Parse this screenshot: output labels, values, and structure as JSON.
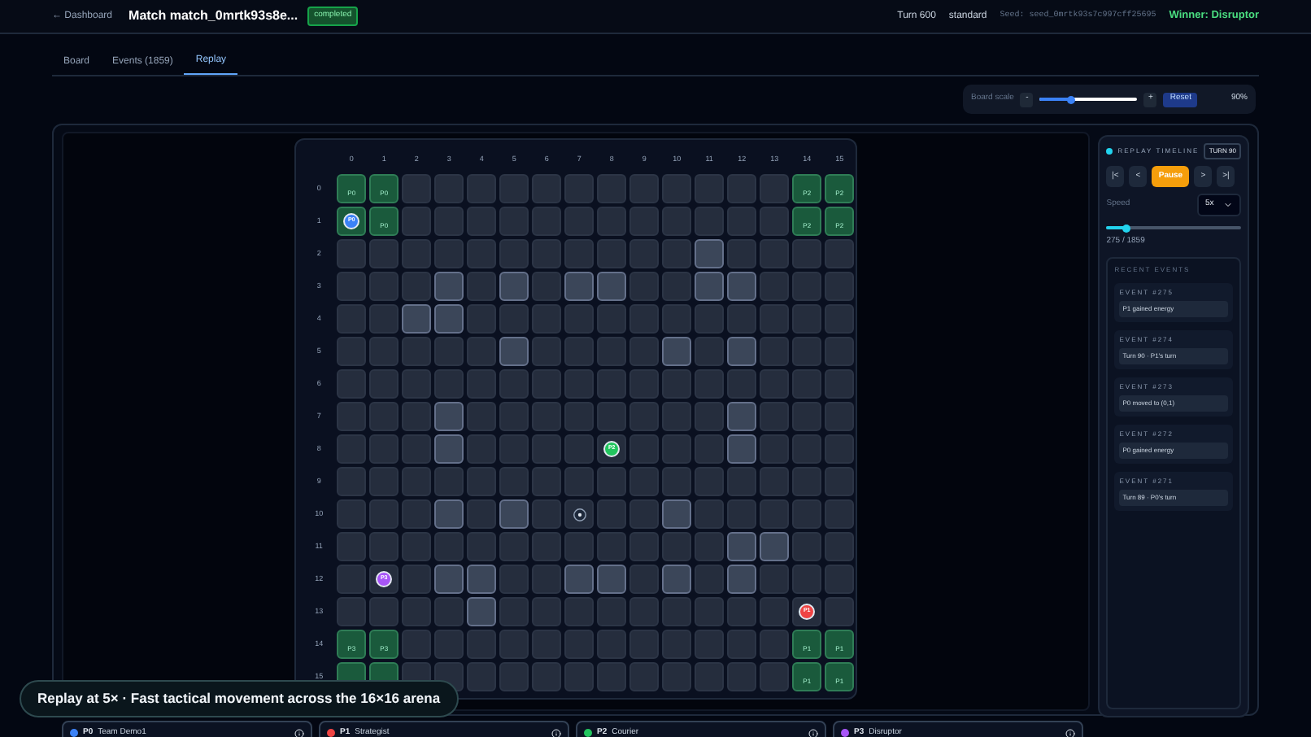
{
  "header": {
    "back_link": "← Dashboard",
    "title": "Match match_0mrtk93s8e...",
    "status_badge": "completed",
    "turn": "Turn 600",
    "mode": "standard",
    "seed": "Seed: seed_0mrtk93s7c997cff25695",
    "winner": "Winner: Disruptor"
  },
  "tabs": [
    {
      "label": "Board",
      "selected": false
    },
    {
      "label": "Events (1859)",
      "selected": false
    },
    {
      "label": "Replay",
      "selected": true
    }
  ],
  "board_scale": {
    "label": "Board scale",
    "minus": "-",
    "plus": "+",
    "level": 0.32,
    "reset": "Reset",
    "value": "90%"
  },
  "board": {
    "column_labels": [
      "0",
      "1",
      "2",
      "3",
      "4",
      "5",
      "6",
      "7",
      "8",
      "9",
      "10",
      "11",
      "12",
      "13",
      "14",
      "15"
    ],
    "rows": [
      {
        "label": "0",
        "cells": [
          {
            "kind": "base",
            "label": "P0"
          },
          {
            "kind": "base",
            "label": "P0"
          },
          {
            "kind": "empty"
          },
          {
            "kind": "empty"
          },
          {
            "kind": "empty"
          },
          {
            "kind": "empty"
          },
          {
            "kind": "empty"
          },
          {
            "kind": "empty"
          },
          {
            "kind": "empty"
          },
          {
            "kind": "empty"
          },
          {
            "kind": "empty"
          },
          {
            "kind": "empty"
          },
          {
            "kind": "empty"
          },
          {
            "kind": "empty"
          },
          {
            "kind": "base",
            "label": "P2"
          },
          {
            "kind": "base",
            "label": "P2"
          }
        ]
      },
      {
        "label": "1",
        "cells": [
          {
            "kind": "base_token",
            "label": "P0",
            "color": "#3b82f6"
          },
          {
            "kind": "base",
            "label": "P0"
          },
          {
            "kind": "empty"
          },
          {
            "kind": "empty"
          },
          {
            "kind": "empty"
          },
          {
            "kind": "empty"
          },
          {
            "kind": "empty"
          },
          {
            "kind": "empty"
          },
          {
            "kind": "empty"
          },
          {
            "kind": "empty"
          },
          {
            "kind": "empty"
          },
          {
            "kind": "empty"
          },
          {
            "kind": "empty"
          },
          {
            "kind": "empty"
          },
          {
            "kind": "base",
            "label": "P2"
          },
          {
            "kind": "base",
            "label": "P2"
          }
        ]
      },
      {
        "label": "2",
        "cells": [
          {
            "kind": "empty"
          },
          {
            "kind": "empty"
          },
          {
            "kind": "empty"
          },
          {
            "kind": "empty"
          },
          {
            "kind": "empty"
          },
          {
            "kind": "empty"
          },
          {
            "kind": "empty"
          },
          {
            "kind": "empty"
          },
          {
            "kind": "empty"
          },
          {
            "kind": "empty"
          },
          {
            "kind": "empty"
          },
          {
            "kind": "wall"
          },
          {
            "kind": "empty"
          },
          {
            "kind": "empty"
          },
          {
            "kind": "empty"
          },
          {
            "kind": "empty"
          }
        ]
      },
      {
        "label": "3",
        "cells": [
          {
            "kind": "empty"
          },
          {
            "kind": "empty"
          },
          {
            "kind": "empty"
          },
          {
            "kind": "wall"
          },
          {
            "kind": "empty"
          },
          {
            "kind": "wall"
          },
          {
            "kind": "empty"
          },
          {
            "kind": "wall"
          },
          {
            "kind": "wall"
          },
          {
            "kind": "empty"
          },
          {
            "kind": "empty"
          },
          {
            "kind": "wall"
          },
          {
            "kind": "wall"
          },
          {
            "kind": "empty"
          },
          {
            "kind": "empty"
          },
          {
            "kind": "empty"
          }
        ]
      },
      {
        "label": "4",
        "cells": [
          {
            "kind": "empty"
          },
          {
            "kind": "empty"
          },
          {
            "kind": "wall"
          },
          {
            "kind": "wall"
          },
          {
            "kind": "empty"
          },
          {
            "kind": "empty"
          },
          {
            "kind": "empty"
          },
          {
            "kind": "empty"
          },
          {
            "kind": "empty"
          },
          {
            "kind": "empty"
          },
          {
            "kind": "empty"
          },
          {
            "kind": "empty"
          },
          {
            "kind": "empty"
          },
          {
            "kind": "empty"
          },
          {
            "kind": "empty"
          },
          {
            "kind": "empty"
          }
        ]
      },
      {
        "label": "5",
        "cells": [
          {
            "kind": "empty"
          },
          {
            "kind": "empty"
          },
          {
            "kind": "empty"
          },
          {
            "kind": "empty"
          },
          {
            "kind": "empty"
          },
          {
            "kind": "wall"
          },
          {
            "kind": "empty"
          },
          {
            "kind": "empty"
          },
          {
            "kind": "empty"
          },
          {
            "kind": "empty"
          },
          {
            "kind": "wall"
          },
          {
            "kind": "empty"
          },
          {
            "kind": "wall"
          },
          {
            "kind": "empty"
          },
          {
            "kind": "empty"
          },
          {
            "kind": "empty"
          }
        ]
      },
      {
        "label": "6",
        "cells": [
          {
            "kind": "empty"
          },
          {
            "kind": "empty"
          },
          {
            "kind": "empty"
          },
          {
            "kind": "empty"
          },
          {
            "kind": "empty"
          },
          {
            "kind": "empty"
          },
          {
            "kind": "empty"
          },
          {
            "kind": "empty"
          },
          {
            "kind": "empty"
          },
          {
            "kind": "empty"
          },
          {
            "kind": "empty"
          },
          {
            "kind": "empty"
          },
          {
            "kind": "empty"
          },
          {
            "kind": "empty"
          },
          {
            "kind": "empty"
          },
          {
            "kind": "empty"
          }
        ]
      },
      {
        "label": "7",
        "cells": [
          {
            "kind": "empty"
          },
          {
            "kind": "empty"
          },
          {
            "kind": "empty"
          },
          {
            "kind": "wall"
          },
          {
            "kind": "empty"
          },
          {
            "kind": "empty"
          },
          {
            "kind": "empty"
          },
          {
            "kind": "empty"
          },
          {
            "kind": "empty"
          },
          {
            "kind": "empty"
          },
          {
            "kind": "empty"
          },
          {
            "kind": "empty"
          },
          {
            "kind": "wall"
          },
          {
            "kind": "empty"
          },
          {
            "kind": "empty"
          },
          {
            "kind": "empty"
          }
        ]
      },
      {
        "label": "8",
        "cells": [
          {
            "kind": "empty"
          },
          {
            "kind": "empty"
          },
          {
            "kind": "empty"
          },
          {
            "kind": "wall"
          },
          {
            "kind": "empty"
          },
          {
            "kind": "empty"
          },
          {
            "kind": "empty"
          },
          {
            "kind": "empty"
          },
          {
            "kind": "token",
            "label": "P2",
            "color": "#22c55e"
          },
          {
            "kind": "empty"
          },
          {
            "kind": "empty"
          },
          {
            "kind": "empty"
          },
          {
            "kind": "wall"
          },
          {
            "kind": "empty"
          },
          {
            "kind": "empty"
          },
          {
            "kind": "empty"
          }
        ]
      },
      {
        "label": "9",
        "cells": [
          {
            "kind": "empty"
          },
          {
            "kind": "empty"
          },
          {
            "kind": "empty"
          },
          {
            "kind": "empty"
          },
          {
            "kind": "empty"
          },
          {
            "kind": "empty"
          },
          {
            "kind": "empty"
          },
          {
            "kind": "empty"
          },
          {
            "kind": "empty"
          },
          {
            "kind": "empty"
          },
          {
            "kind": "empty"
          },
          {
            "kind": "empty"
          },
          {
            "kind": "empty"
          },
          {
            "kind": "empty"
          },
          {
            "kind": "empty"
          },
          {
            "kind": "empty"
          }
        ]
      },
      {
        "label": "10",
        "cells": [
          {
            "kind": "empty"
          },
          {
            "kind": "empty"
          },
          {
            "kind": "empty"
          },
          {
            "kind": "wall"
          },
          {
            "kind": "empty"
          },
          {
            "kind": "wall"
          },
          {
            "kind": "empty"
          },
          {
            "kind": "marker"
          },
          {
            "kind": "empty"
          },
          {
            "kind": "empty"
          },
          {
            "kind": "wall"
          },
          {
            "kind": "empty"
          },
          {
            "kind": "empty"
          },
          {
            "kind": "empty"
          },
          {
            "kind": "empty"
          },
          {
            "kind": "empty"
          }
        ]
      },
      {
        "label": "11",
        "cells": [
          {
            "kind": "empty"
          },
          {
            "kind": "empty"
          },
          {
            "kind": "empty"
          },
          {
            "kind": "empty"
          },
          {
            "kind": "empty"
          },
          {
            "kind": "empty"
          },
          {
            "kind": "empty"
          },
          {
            "kind": "empty"
          },
          {
            "kind": "empty"
          },
          {
            "kind": "empty"
          },
          {
            "kind": "empty"
          },
          {
            "kind": "empty"
          },
          {
            "kind": "wall"
          },
          {
            "kind": "wall"
          },
          {
            "kind": "empty"
          },
          {
            "kind": "empty"
          }
        ]
      },
      {
        "label": "12",
        "cells": [
          {
            "kind": "empty"
          },
          {
            "kind": "token",
            "label": "P3",
            "color": "#a855f7"
          },
          {
            "kind": "empty"
          },
          {
            "kind": "wall"
          },
          {
            "kind": "wall"
          },
          {
            "kind": "empty"
          },
          {
            "kind": "empty"
          },
          {
            "kind": "wall"
          },
          {
            "kind": "wall"
          },
          {
            "kind": "empty"
          },
          {
            "kind": "wall"
          },
          {
            "kind": "empty"
          },
          {
            "kind": "wall"
          },
          {
            "kind": "empty"
          },
          {
            "kind": "empty"
          },
          {
            "kind": "empty"
          }
        ]
      },
      {
        "label": "13",
        "cells": [
          {
            "kind": "empty"
          },
          {
            "kind": "empty"
          },
          {
            "kind": "empty"
          },
          {
            "kind": "empty"
          },
          {
            "kind": "wall"
          },
          {
            "kind": "empty"
          },
          {
            "kind": "empty"
          },
          {
            "kind": "empty"
          },
          {
            "kind": "empty"
          },
          {
            "kind": "empty"
          },
          {
            "kind": "empty"
          },
          {
            "kind": "empty"
          },
          {
            "kind": "empty"
          },
          {
            "kind": "empty"
          },
          {
            "kind": "token",
            "label": "P1",
            "color": "#ef4444"
          },
          {
            "kind": "empty"
          }
        ]
      },
      {
        "label": "14",
        "cells": [
          {
            "kind": "base",
            "label": "P3"
          },
          {
            "kind": "base",
            "label": "P3"
          },
          {
            "kind": "empty"
          },
          {
            "kind": "empty"
          },
          {
            "kind": "empty"
          },
          {
            "kind": "empty"
          },
          {
            "kind": "empty"
          },
          {
            "kind": "empty"
          },
          {
            "kind": "empty"
          },
          {
            "kind": "empty"
          },
          {
            "kind": "empty"
          },
          {
            "kind": "empty"
          },
          {
            "kind": "empty"
          },
          {
            "kind": "empty"
          },
          {
            "kind": "base",
            "label": "P1"
          },
          {
            "kind": "base",
            "label": "P1"
          }
        ]
      },
      {
        "label": "15",
        "cells": [
          {
            "kind": "base"
          },
          {
            "kind": "base"
          },
          {
            "kind": "empty"
          },
          {
            "kind": "empty"
          },
          {
            "kind": "empty"
          },
          {
            "kind": "empty"
          },
          {
            "kind": "empty"
          },
          {
            "kind": "empty"
          },
          {
            "kind": "empty"
          },
          {
            "kind": "empty"
          },
          {
            "kind": "empty"
          },
          {
            "kind": "empty"
          },
          {
            "kind": "empty"
          },
          {
            "kind": "empty"
          },
          {
            "kind": "base",
            "label": "P1"
          },
          {
            "kind": "base",
            "label": "P1"
          }
        ]
      }
    ]
  },
  "timeline": {
    "title": "REPLAY TIMELINE",
    "turn_badge": "TURN 90",
    "controls": [
      {
        "label": "|<",
        "kind": "normal"
      },
      {
        "label": "<",
        "kind": "normal"
      },
      {
        "label": "Pause",
        "kind": "primary"
      },
      {
        "label": ">",
        "kind": "normal"
      },
      {
        "label": ">|",
        "kind": "normal"
      }
    ],
    "speed_label": "Speed",
    "speed_value": "5x",
    "level": 0.15,
    "progress": "275 / 1859",
    "recent_events": {
      "title": "RECENT EVENTS",
      "items": [
        {
          "header": "EVENT #275",
          "text": "P1 gained energy"
        },
        {
          "header": "EVENT #274",
          "text": "Turn 90 · P1's turn"
        },
        {
          "header": "EVENT #273",
          "text": "P0 moved to (0,1)"
        },
        {
          "header": "EVENT #272",
          "text": "P0 gained energy"
        },
        {
          "header": "EVENT #271",
          "text": "Turn 89 · P0's turn"
        }
      ]
    }
  },
  "caption": "Replay at 5× · Fast tactical movement across the 16×16 arena",
  "players": [
    {
      "id": "P0",
      "name": "Team Demo1",
      "color": "#3b82f6"
    },
    {
      "id": "P1",
      "name": "Strategist",
      "color": "#ef4444"
    },
    {
      "id": "P2",
      "name": "Courier",
      "color": "#22c55e"
    },
    {
      "id": "P3",
      "name": "Disruptor",
      "color": "#a855f7"
    }
  ]
}
